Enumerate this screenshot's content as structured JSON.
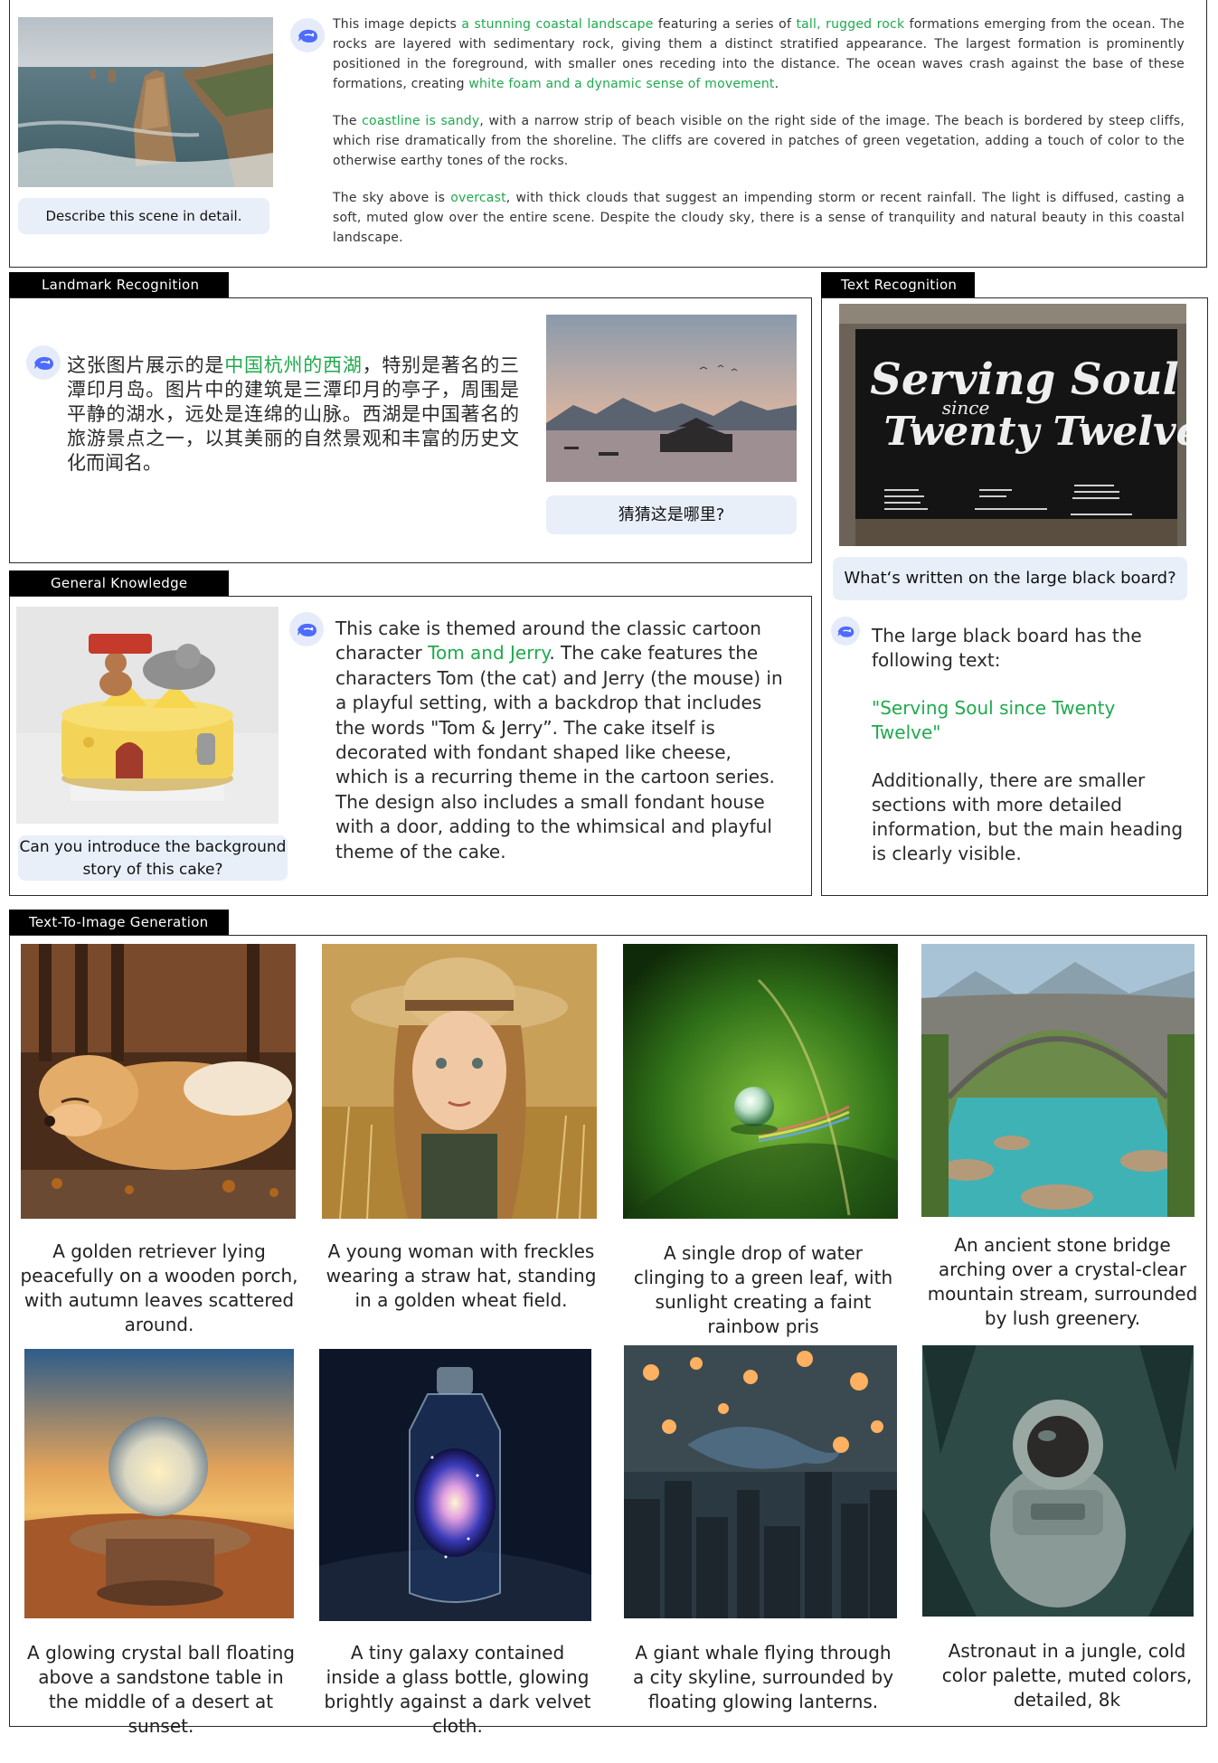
{
  "scene": {
    "prompt": "Describe this scene in detail.",
    "p1": [
      {
        "t": "This image depicts "
      },
      {
        "t": "a stunning coastal landscape",
        "hl": true
      },
      {
        "t": " featuring a series of "
      },
      {
        "t": "tall, rugged rock",
        "hl": true
      },
      {
        "t": " formations emerging from the ocean. The rocks are layered with sedimentary rock, giving them a distinct stratified appearance. The largest formation is prominently positioned in the foreground, with smaller ones receding into the distance. The ocean waves crash against the base of these formations, creating "
      },
      {
        "t": "white foam and a dynamic sense of movement",
        "hl": true
      },
      {
        "t": "."
      }
    ],
    "p2": [
      {
        "t": "The "
      },
      {
        "t": "coastline is sandy",
        "hl": true
      },
      {
        "t": ", with a narrow strip of beach visible on the right side of the image. The beach is bordered by steep cliffs, which rise dramatically from the shoreline. The cliffs are covered in patches of green vegetation, adding a touch of color to the otherwise earthy tones of the rocks."
      }
    ],
    "p3": [
      {
        "t": "The sky above is "
      },
      {
        "t": "overcast",
        "hl": true
      },
      {
        "t": ", with thick clouds that suggest an impending storm or recent rainfall. The light is diffused, casting a soft, muted glow over the entire scene. Despite the cloudy sky, there is a sense of tranquility and natural beauty in this coastal landscape."
      }
    ]
  },
  "landmark": {
    "tab": "Landmark Recognition",
    "answer": [
      {
        "t": "这张图片展示的是"
      },
      {
        "t": "中国杭州的西湖",
        "hl": true
      },
      {
        "t": "，特别是著名的三潭印月岛。图片中的建筑是三潭印月的亭子，周围是平静的湖水，远处是连绵的山脉。西湖是中国著名的旅游景点之一，以其美丽的自然景观和丰富的历史文化而闻名。"
      }
    ],
    "prompt": "猜猜这是哪里?"
  },
  "text_recognition": {
    "tab": "Text Recognition",
    "sign_line1": "Serving Soul",
    "sign_since": "since",
    "sign_line2": "Twenty Twelve",
    "prompt": "What‘s written on the large black board?",
    "answer_intro": "The large black board has the following text:",
    "answer_quote": "\"Serving Soul since Twenty Twelve\"",
    "answer_more": "Additionally, there are smaller sections with more detailed information, but the main heading is clearly visible."
  },
  "knowledge": {
    "tab": "General Knowledge",
    "prompt": "Can you introduce the background story of this cake?",
    "answer": [
      {
        "t": "This cake is themed around the classic cartoon character "
      },
      {
        "t": "Tom and Jerry",
        "hl": true
      },
      {
        "t": ". The cake features the characters Tom (the cat) and Jerry (the mouse) in a playful setting, with a backdrop that includes the words \"Tom & Jerry”. The cake itself is decorated with fondant shaped like cheese, which is a recurring theme in the cartoon series. The design also includes a small fondant house with a door, adding to the whimsical and playful theme of the cake."
      }
    ]
  },
  "t2i": {
    "tab": "Text-To-Image Generation",
    "items": [
      {
        "caption": "A golden retriever lying peacefully on a wooden porch, with autumn leaves scattered around."
      },
      {
        "caption": "A young woman with freckles wearing a straw hat, standing in a golden wheat field."
      },
      {
        "caption": "A single drop of water clinging to a green leaf, with sunlight creating a faint rainbow pris"
      },
      {
        "caption": "An ancient stone bridge arching over a crystal-clear mountain stream, surrounded by lush greenery."
      },
      {
        "caption": "A glowing crystal ball floating above a sandstone table in the middle of a desert at sunset."
      },
      {
        "caption": "A tiny galaxy contained inside a glass bottle, glowing brightly against a dark velvet cloth."
      },
      {
        "caption": "A giant whale flying through a city skyline, surrounded by floating glowing lanterns."
      },
      {
        "caption": "Astronaut in a jungle, cold color palette, muted colors, detailed, 8k"
      }
    ]
  },
  "colors": {
    "highlight": "#1faa4d",
    "prompt_bg": "#e8eff8",
    "tab_bg": "#000000"
  },
  "icons": {
    "assistant": "whale-logo-icon"
  }
}
